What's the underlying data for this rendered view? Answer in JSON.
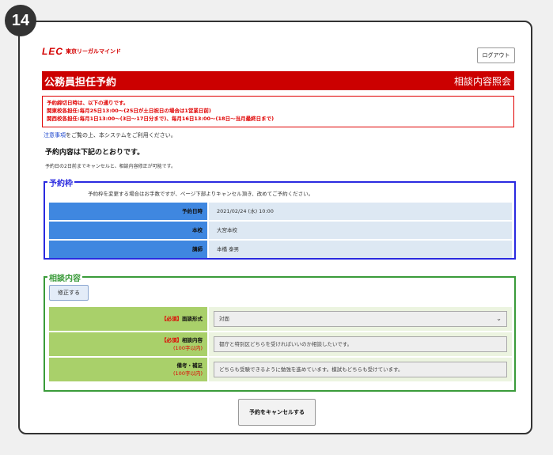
{
  "step_number": "14",
  "header": {
    "logo_mark": "LEC",
    "logo_text": "東京リーガルマインド",
    "logout_label": "ログアウト"
  },
  "title_bar": {
    "left": "公務員担任予約",
    "right": "相談内容照会"
  },
  "notice": {
    "lines": [
      "予約締切日時は、以下の通りです。",
      "関東校各担任:毎月25日13:00～(25日が土日祝日の場合は1営業日前)",
      "関西校各担任:毎月1日13:00～(3日～17日分まで)、毎月16日13:00～(18日～当月最終日まで)"
    ]
  },
  "caution": {
    "link": "注意事項",
    "text": "をご覧の上、本システムをご利用ください。"
  },
  "heading": "予約内容は下記のとおりです。",
  "subnote": "予約日の2日前までキャンセルと、相談内容修正が可能です。",
  "reservation": {
    "legend": "予約枠",
    "note": "予約枠を変更する場合はお手数ですが、ページ下部よりキャンセル頂き、改めてご予約ください。",
    "rows": [
      {
        "label": "予約日時",
        "value": "2021/02/24 (水) 10:00"
      },
      {
        "label": "本校",
        "value": "大宮本校"
      },
      {
        "label": "講師",
        "value": "本橋 泰男"
      }
    ]
  },
  "consult": {
    "legend": "相談内容",
    "edit_label": "修正する",
    "rows": [
      {
        "req": "【必須】",
        "label": "面談形式",
        "limit": "",
        "value": "対面",
        "type": "select"
      },
      {
        "req": "【必須】",
        "label": "相談内容",
        "limit": "(100字以内)",
        "value": "都庁と特別区どちらを受ければいいのか相談したいです。",
        "type": "text"
      },
      {
        "req": "",
        "label": "備考・補足",
        "limit": "(100字以内)",
        "value": "どちらも受験できるように勉強を進めています。模試もどちらも受けています。",
        "type": "text"
      }
    ]
  },
  "cancel_label": "予約をキャンセルする"
}
